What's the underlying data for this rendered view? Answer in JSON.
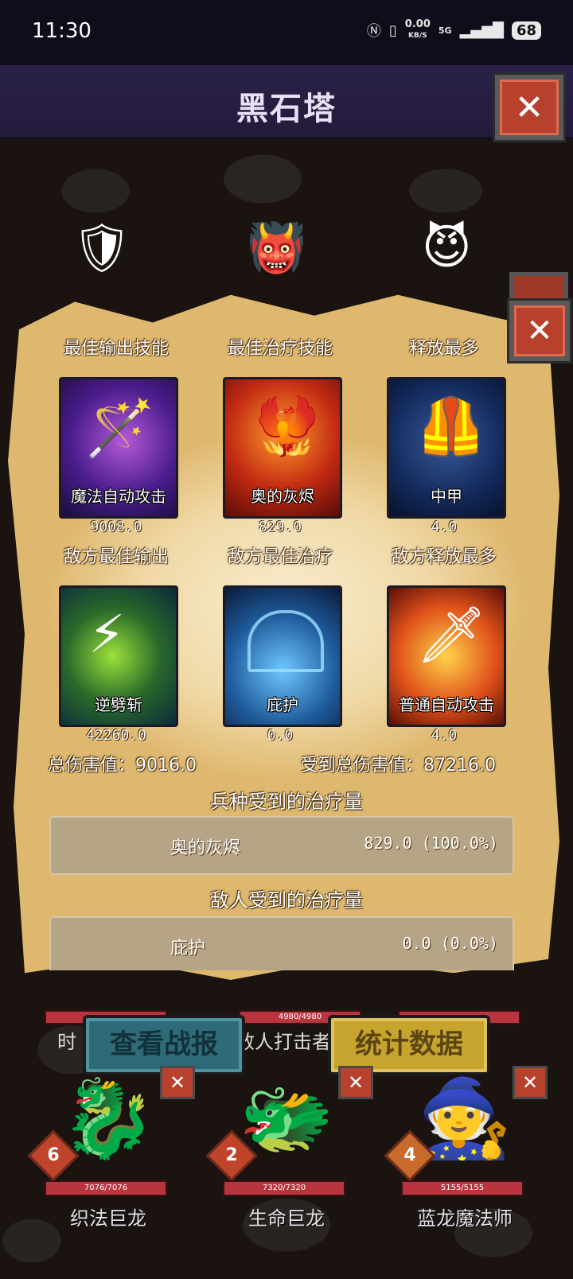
{
  "status_bar": {
    "time": "11:30",
    "net_rate_value": "0.00",
    "net_rate_unit": "KB/S",
    "signal": "5G",
    "battery": "68"
  },
  "header": {
    "title": "黑石塔"
  },
  "stats": {
    "columns": [
      "最佳输出技能",
      "最佳治疗技能",
      "释放最多"
    ],
    "top_skills": [
      {
        "name": "魔法自动攻击",
        "value": "9008.0"
      },
      {
        "name": "奥的灰烬",
        "value": "829.0"
      },
      {
        "name": "中甲",
        "value": "4.0"
      }
    ],
    "enemy_columns": [
      "敌方最佳输出",
      "敌方最佳治疗",
      "敌方释放最多"
    ],
    "enemy_skills": [
      {
        "name": "逆劈斩",
        "value": "42260.0"
      },
      {
        "name": "庇护",
        "value": "0.0"
      },
      {
        "name": "普通自动攻击",
        "value": "4.0"
      }
    ],
    "total_damage": "总伤害值：9016.0",
    "total_damage_taken": "受到总伤害值：87216.0",
    "ally_heal_title": "兵种受到的治疗量",
    "ally_heal_rows": [
      {
        "name": "奥的灰烬",
        "value": "829.0 (100.0%)"
      }
    ],
    "enemy_heal_title": "敌人受到的治疗量",
    "enemy_heal_rows": [
      {
        "name": "庇护",
        "value": "0.0 (0.0%)"
      }
    ]
  },
  "buttons": {
    "report": "查看战报",
    "stats": "统计数据"
  },
  "behind": {
    "left_text": "时",
    "mid_hp": "4980/4980",
    "mid_text": "敌人打击者"
  },
  "units": [
    {
      "level": "6",
      "hp": "7076/7076",
      "name": "织法巨龙"
    },
    {
      "level": "2",
      "hp": "7320/7320",
      "name": "生命巨龙"
    },
    {
      "level": "4",
      "hp": "5155/5155",
      "name": "蓝龙魔法师"
    }
  ],
  "colors": {
    "parchment": "#f0d9a6",
    "title_bar": "#2a2147",
    "close_button": "#b8412e",
    "report_button": "#2f6a78",
    "stats_button": "#c7a42e"
  }
}
